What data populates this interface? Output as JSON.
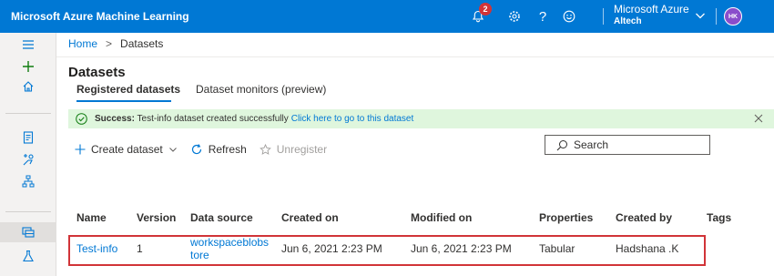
{
  "topbar": {
    "app_title": "Microsoft Azure Machine Learning",
    "notification_count": "2",
    "help_glyph": "?",
    "account_name": "Microsoft Azure",
    "account_directory": "Altech",
    "avatar_initials": "HK",
    "brand_color": "#0078d4"
  },
  "leftnav": {
    "icons": [
      "hamburger-icon",
      "plus-icon",
      "home-icon",
      "notebook-icon",
      "automl-icon",
      "designer-icon",
      "datasets-icon",
      "experiments-icon"
    ],
    "selected": "datasets-icon"
  },
  "breadcrumb": {
    "home": "Home",
    "separator": ">",
    "current": "Datasets"
  },
  "page": {
    "title": "Datasets"
  },
  "tabs": [
    {
      "label": "Registered datasets",
      "selected": true
    },
    {
      "label": "Dataset monitors (preview)",
      "selected": false
    }
  ],
  "banner": {
    "prefix": "Success:",
    "message": "Test-info dataset created successfully",
    "link": "Click here to go to this dataset",
    "color": "#dff6dd"
  },
  "toolbar": {
    "create_label": "Create dataset",
    "refresh_label": "Refresh",
    "unregister_label": "Unregister",
    "search_placeholder": "Search"
  },
  "table": {
    "headers": [
      "Name",
      "Version",
      "Data source",
      "Created on",
      "Modified on",
      "Properties",
      "Created by",
      "Tags"
    ],
    "rows": [
      {
        "name": "Test-info",
        "version": "1",
        "data_source_line1": "workspaceblobs",
        "data_source_line2": "tore",
        "created_on": "Jun 6, 2021 2:23 PM",
        "modified_on": "Jun 6, 2021 2:23 PM",
        "properties": "Tabular",
        "created_by": "Hadshana .K",
        "tags": ""
      }
    ]
  }
}
